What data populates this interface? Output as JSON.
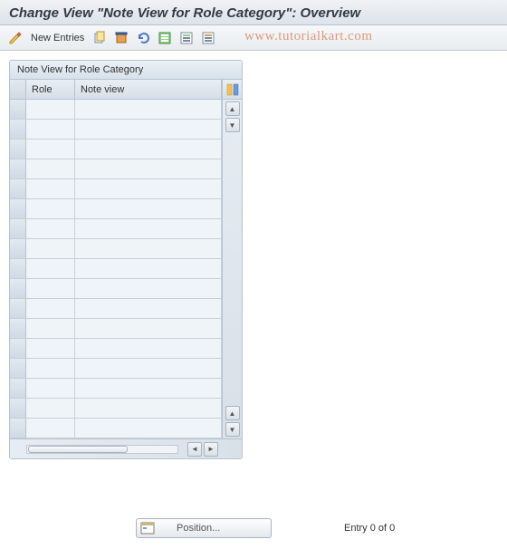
{
  "header": {
    "title": "Change View \"Note View for Role Category\": Overview"
  },
  "toolbar": {
    "new_entries_label": "New Entries"
  },
  "watermark": "www.tutorialkart.com",
  "table": {
    "title": "Note View for Role Category",
    "columns": {
      "role": "Role",
      "noteview": "Note view"
    },
    "rows": [
      {
        "role": "",
        "noteview": ""
      },
      {
        "role": "",
        "noteview": ""
      },
      {
        "role": "",
        "noteview": ""
      },
      {
        "role": "",
        "noteview": ""
      },
      {
        "role": "",
        "noteview": ""
      },
      {
        "role": "",
        "noteview": ""
      },
      {
        "role": "",
        "noteview": ""
      },
      {
        "role": "",
        "noteview": ""
      },
      {
        "role": "",
        "noteview": ""
      },
      {
        "role": "",
        "noteview": ""
      },
      {
        "role": "",
        "noteview": ""
      },
      {
        "role": "",
        "noteview": ""
      },
      {
        "role": "",
        "noteview": ""
      },
      {
        "role": "",
        "noteview": ""
      },
      {
        "role": "",
        "noteview": ""
      },
      {
        "role": "",
        "noteview": ""
      },
      {
        "role": "",
        "noteview": ""
      }
    ]
  },
  "footer": {
    "position_label": "Position...",
    "entry_status": "Entry 0 of 0"
  }
}
